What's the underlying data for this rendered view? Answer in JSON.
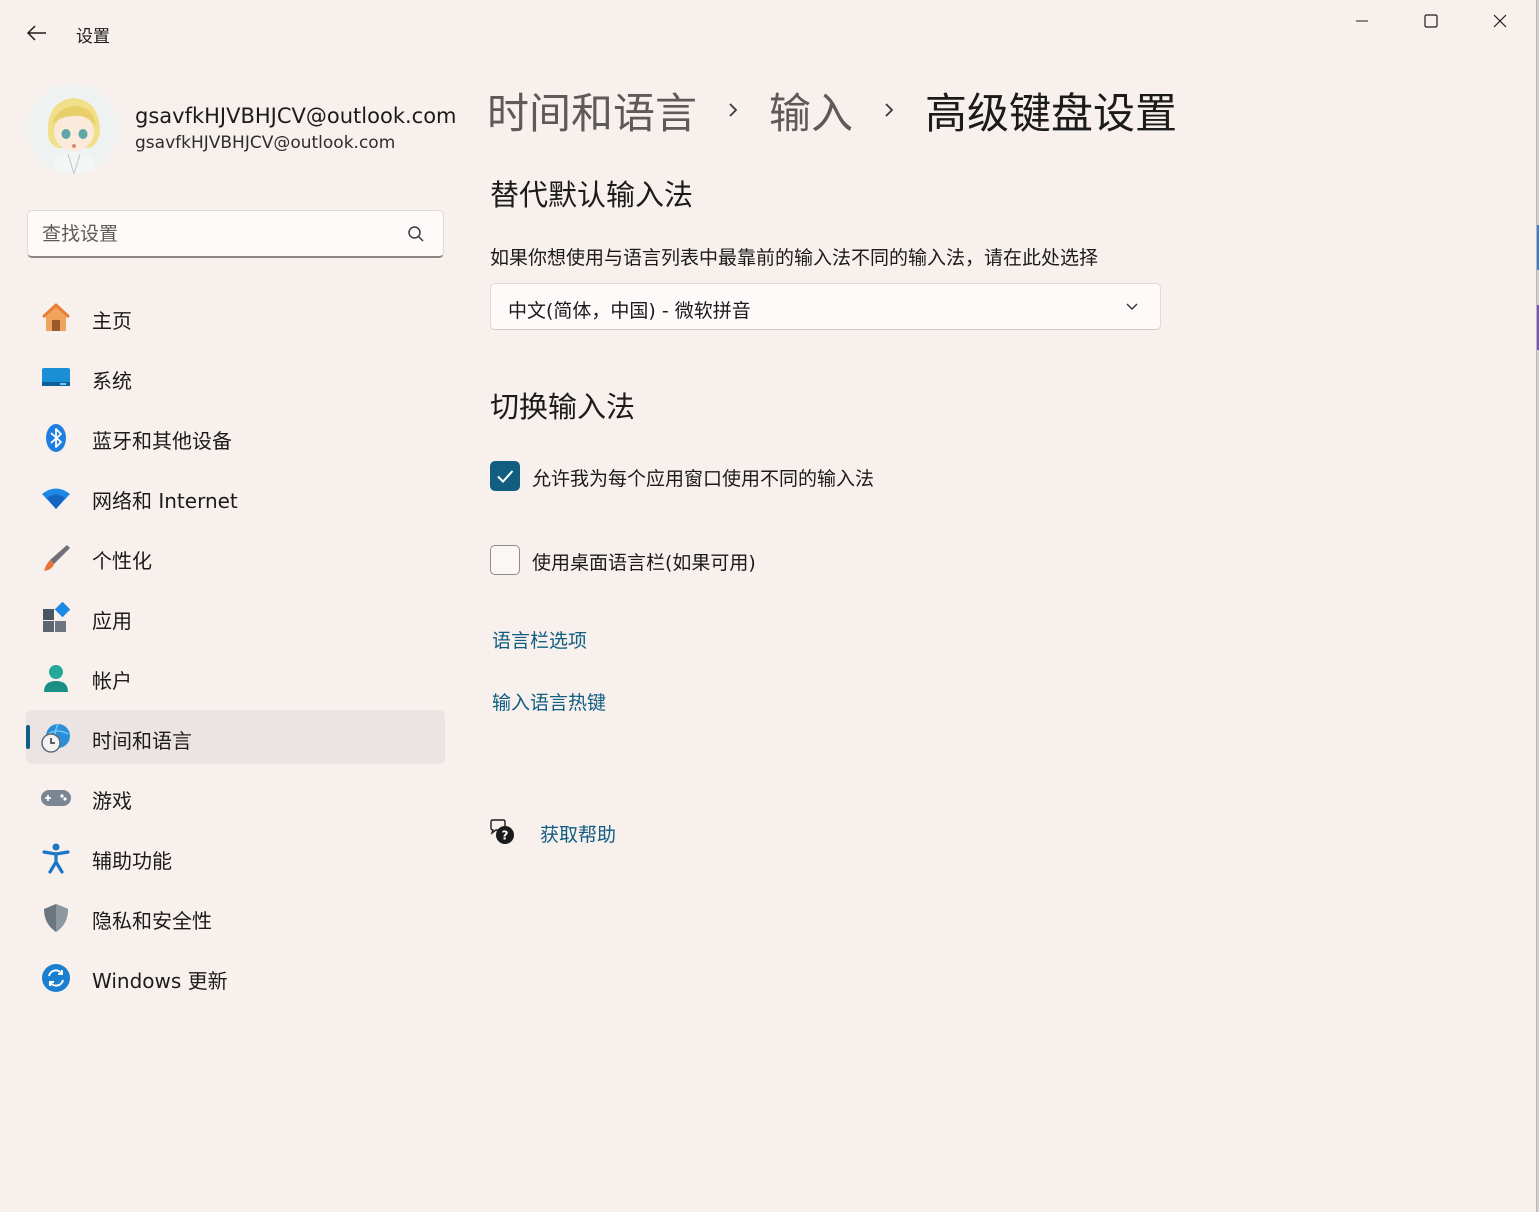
{
  "window": {
    "title": "设置",
    "controls": [
      "minimize-icon",
      "maximize-icon",
      "close-icon"
    ]
  },
  "profile": {
    "name": "gsavfkHJVBHJCV@outlook.com",
    "email": "gsavfkHJVBHJCV@outlook.com"
  },
  "search": {
    "placeholder": "查找设置"
  },
  "sidebar": {
    "items": [
      {
        "label": "主页",
        "icon": "home-icon"
      },
      {
        "label": "系统",
        "icon": "system-icon"
      },
      {
        "label": "蓝牙和其他设备",
        "icon": "bluetooth-icon"
      },
      {
        "label": "网络和 Internet",
        "icon": "wifi-icon"
      },
      {
        "label": "个性化",
        "icon": "brush-icon"
      },
      {
        "label": "应用",
        "icon": "apps-icon"
      },
      {
        "label": "帐户",
        "icon": "account-icon"
      },
      {
        "label": "时间和语言",
        "icon": "time-language-icon",
        "active": true
      },
      {
        "label": "游戏",
        "icon": "gamepad-icon"
      },
      {
        "label": "辅助功能",
        "icon": "accessibility-icon"
      },
      {
        "label": "隐私和安全性",
        "icon": "shield-icon"
      },
      {
        "label": "Windows 更新",
        "icon": "update-icon"
      }
    ]
  },
  "breadcrumb": {
    "items": [
      "时间和语言",
      "输入",
      "高级键盘设置"
    ]
  },
  "main": {
    "section1_title": "替代默认输入法",
    "section1_desc": "如果你想使用与语言列表中最靠前的输入法不同的输入法，请在此处选择",
    "dropdown_value": "中文(简体，中国) - 微软拼音",
    "section2_title": "切换输入法",
    "checkbox1_label": "允许我为每个应用窗口使用不同的输入法",
    "checkbox1_checked": true,
    "checkbox2_label": "使用桌面语言栏(如果可用)",
    "checkbox2_checked": false,
    "link1": "语言栏选项",
    "link2": "输入语言热键",
    "help_link": "获取帮助"
  },
  "colors": {
    "accent": "#125e80",
    "link": "#0f5d80",
    "background": "#f8f0ed"
  }
}
